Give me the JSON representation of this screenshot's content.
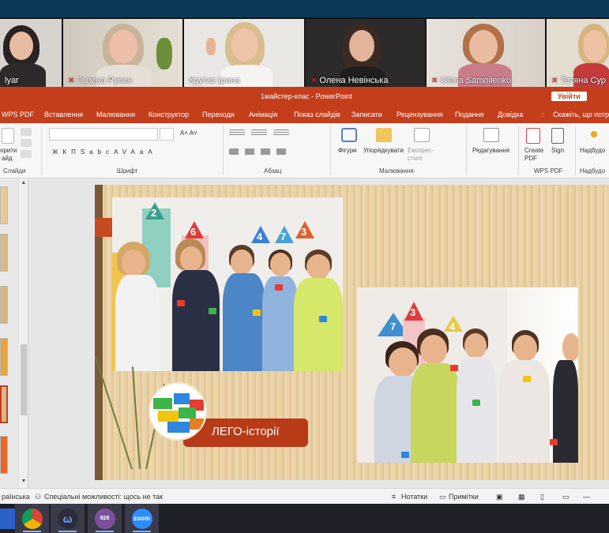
{
  "participants": [
    {
      "name": "lyar",
      "muted": false
    },
    {
      "name": "Галина Русин",
      "muted": true
    },
    {
      "name": "Крутко Ірина",
      "muted": false
    },
    {
      "name": "Олена Невінська",
      "muted": true
    },
    {
      "name": "Olena  Samoilenko",
      "muted": true
    },
    {
      "name": "Тетяна Сур",
      "muted": true
    }
  ],
  "app": {
    "title": "1майстер-клас  -  PowerPoint",
    "signin_label": "Увійти",
    "tell_me": "Скажіть, що потрі",
    "menu": [
      "WPS PDF",
      "Вставлення",
      "Малювання",
      "Конструктор",
      "Переходи",
      "Анімація",
      "Показ слайдів",
      "Записати",
      "Рецензування",
      "Подання",
      "Довідка"
    ],
    "ribbon": {
      "groups": [
        "Слайди",
        "Шрифт",
        "Абзац",
        "Малювання",
        "WPS PDF",
        "Надбудо"
      ],
      "new_slide_label_1": "орити",
      "new_slide_label_2": "айд",
      "font_buttons": [
        "Ж",
        "К",
        "П",
        "S",
        "abc",
        "AV",
        "Aa",
        "A"
      ],
      "shapes_label": "Фігури",
      "arrange_label": "Упорядкувати",
      "quick_styles_label": "Експрес-стилі",
      "editing_label": "Редагування",
      "create_pdf_label": "Create PDF",
      "sign_label": "Sign",
      "addins_label": "Надбудо"
    }
  },
  "slide": {
    "banner_text": "ЛЕГО-історії",
    "numbers_photo1": [
      "2",
      "6",
      "4",
      "7",
      "3"
    ],
    "numbers_photo2": [
      "7",
      "3",
      "4"
    ]
  },
  "statusbar": {
    "language": "раїнська",
    "accessibility": "Спеціальні можливості: щось не так",
    "notes": "Нотатки",
    "comments": "Примітки"
  },
  "taskbar": {
    "badge_count": "928",
    "zoom_label": "zoom"
  }
}
